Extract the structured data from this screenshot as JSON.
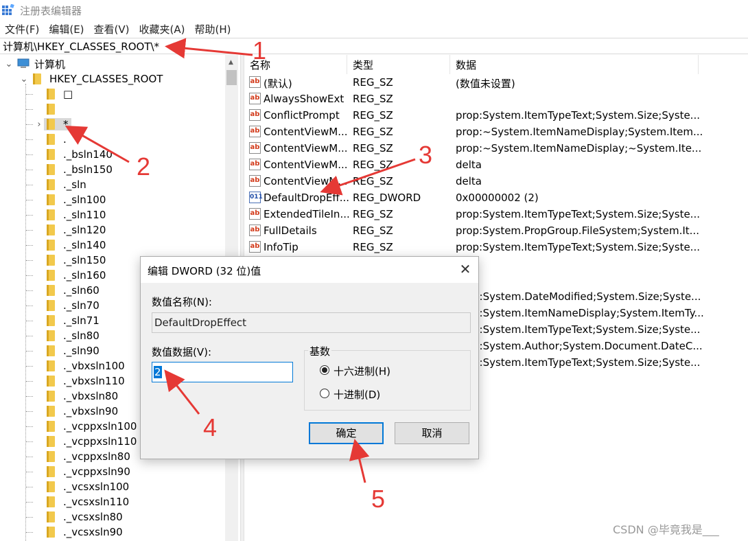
{
  "window": {
    "title": "注册表编辑器",
    "icon": "registry-editor-icon"
  },
  "menu": [
    "文件(F)",
    "编辑(E)",
    "查看(V)",
    "收藏夹(A)",
    "帮助(H)"
  ],
  "address": "计算机\\HKEY_CLASSES_ROOT\\*",
  "tree": {
    "computer": "计算机",
    "root": "HKEY_CLASSES_ROOT",
    "items": [
      "□",
      "",
      "*",
      ".",
      "._bsln140",
      "._bsln150",
      "._sln",
      "._sln100",
      "._sln110",
      "._sln120",
      "._sln140",
      "._sln150",
      "._sln160",
      "._sln60",
      "._sln70",
      "._sln71",
      "._sln80",
      "._sln90",
      "._vbxsln100",
      "._vbxsln110",
      "._vbxsln80",
      "._vbxsln90",
      "._vcppxsln100",
      "._vcppxsln110",
      "._vcppxsln80",
      "._vcppxsln90",
      "._vcsxsln100",
      "._vcsxsln110",
      "._vcsxsln80",
      "._vcsxsln90"
    ]
  },
  "list": {
    "headers": {
      "name": "名称",
      "type": "类型",
      "data": "数据"
    },
    "rows": [
      {
        "name": "(默认)",
        "type": "REG_SZ",
        "data": "(数值未设置)",
        "icon": "ab"
      },
      {
        "name": "AlwaysShowExt",
        "type": "REG_SZ",
        "data": "",
        "icon": "ab"
      },
      {
        "name": "ConflictPrompt",
        "type": "REG_SZ",
        "data": "prop:System.ItemTypeText;System.Size;Syste...",
        "icon": "ab"
      },
      {
        "name": "ContentViewM...",
        "type": "REG_SZ",
        "data": "prop:~System.ItemNameDisplay;System.Item...",
        "icon": "ab"
      },
      {
        "name": "ContentViewM...",
        "type": "REG_SZ",
        "data": "prop:~System.ItemNameDisplay;~System.Ite...",
        "icon": "ab"
      },
      {
        "name": "ContentViewM...",
        "type": "REG_SZ",
        "data": "delta",
        "icon": "ab"
      },
      {
        "name": "ContentViewM...",
        "type": "REG_SZ",
        "data": "delta",
        "icon": "ab"
      },
      {
        "name": "DefaultDropEff...",
        "type": "REG_DWORD",
        "data": "0x00000002 (2)",
        "icon": "dword"
      },
      {
        "name": "ExtendedTileIn...",
        "type": "REG_SZ",
        "data": "prop:System.ItemTypeText;System.Size;Syste...",
        "icon": "ab"
      },
      {
        "name": "FullDetails",
        "type": "REG_SZ",
        "data": "prop:System.PropGroup.FileSystem;System.It...",
        "icon": "ab"
      },
      {
        "name": "InfoTip",
        "type": "REG_SZ",
        "data": "prop:System.ItemTypeText;System.Size;Syste...",
        "icon": "ab"
      }
    ],
    "hidden_rows_data": [
      "p:System.DateModified;System.Size;Syste...",
      "p:System.ItemNameDisplay;System.ItemTy...",
      "p:System.ItemTypeText;System.Size;Syste...",
      "p:System.Author;System.Document.DateC...",
      "p:System.ItemTypeText;System.Size;Syste..."
    ]
  },
  "dialog": {
    "title": "编辑 DWORD (32 位)值",
    "name_label": "数值名称(N):",
    "name_value": "DefaultDropEffect",
    "data_label": "数值数据(V):",
    "data_value": "2",
    "base_label": "基数",
    "radio_hex": "十六进制(H)",
    "radio_dec": "十进制(D)",
    "selected_base": "hex",
    "ok": "确定",
    "cancel": "取消",
    "close": "✕"
  },
  "annotations": [
    "1",
    "2",
    "3",
    "4",
    "5"
  ],
  "watermark": "CSDN @毕竟我是___",
  "colors": {
    "annotation": "#e53935",
    "accent": "#0078d7",
    "folder": "#f2c94c"
  }
}
